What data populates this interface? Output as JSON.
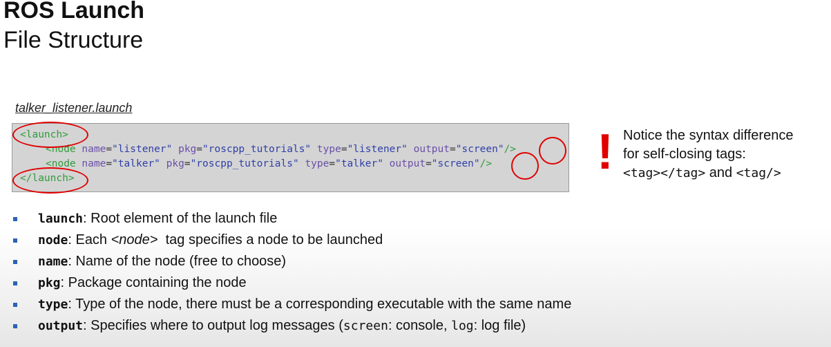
{
  "title": "ROS Launch",
  "subtitle": "File Structure",
  "file_label": "talker_listener.launch",
  "code": {
    "open_tag": "<launch>",
    "close_tag": "</launch>",
    "node1": {
      "tag": "<node",
      "name_attr": "name",
      "name_val": "\"listener\"",
      "pkg_attr": "pkg",
      "pkg_val": "\"roscpp_tutorials\"",
      "type_attr": "type",
      "type_val": "\"listener\"",
      "output_attr": "output",
      "output_val": "\"screen\"",
      "end": "/>"
    },
    "node2": {
      "tag": "<node",
      "name_attr": "name",
      "name_val": "\"talker\"",
      "pkg_attr": "pkg",
      "pkg_val": "\"roscpp_tutorials\"",
      "type_attr": "type",
      "type_val": "\"talker\"",
      "output_attr": "output",
      "output_val": "\"screen\"",
      "end": "/>"
    }
  },
  "notice": {
    "mark": "!",
    "line1": "Notice the syntax difference",
    "line2": "for self-closing tags:",
    "tag_pair": "<tag></tag>",
    "and": " and ",
    "self_closing": "<tag/>"
  },
  "bullets": [
    {
      "key": "launch",
      "text": ": Root element of the launch file"
    },
    {
      "key": "node",
      "text_before": ": Each ",
      "italic": "<node>",
      "text_after": "  tag specifies a node to be launched"
    },
    {
      "key": "name",
      "text": ": Name of the node (free to choose)"
    },
    {
      "key": "pkg",
      "text": ": Package containing the node"
    },
    {
      "key": "type",
      "text": ": Type of the node, there must be a corresponding executable with the same name"
    },
    {
      "key": "output",
      "text_a": ": Specifies where to output log messages (",
      "mono1": "screen",
      "text_b": ": console, ",
      "mono2": "log",
      "text_c": ": log file)"
    }
  ],
  "colors": {
    "highlight": "#e00000",
    "bullet": "#2a62b5",
    "tag": "#2f9b3a"
  }
}
